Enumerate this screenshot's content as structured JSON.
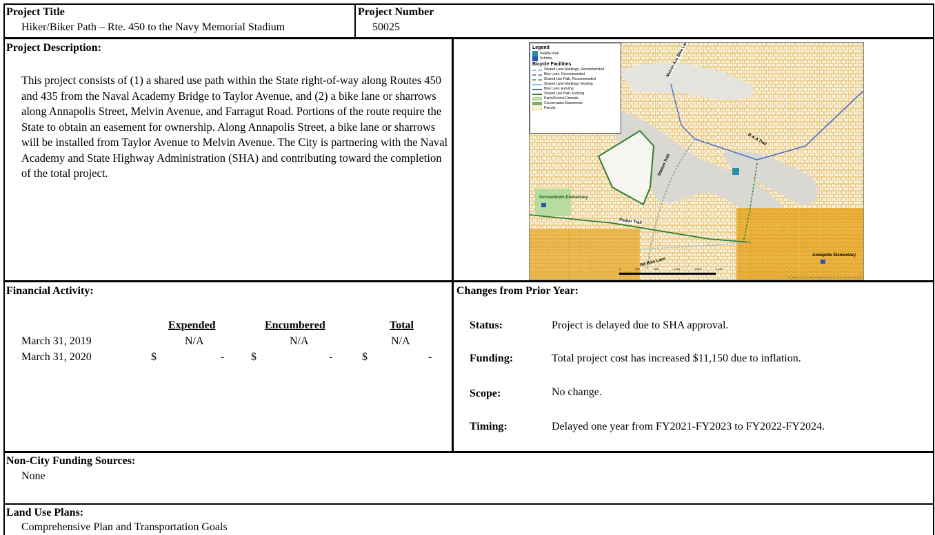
{
  "header": {
    "title_label": "Project Title",
    "title_value": "Hiker/Biker Path – Rte. 450 to the Navy Memorial Stadium",
    "number_label": "Project Number",
    "number_value": "50025"
  },
  "description": {
    "label": "Project Description:",
    "text": "This project consists of (1) a shared use path within the State right-of-way along Routes 450 and 435 from the Naval Academy Bridge to Taylor Avenue, and (2) a bike lane or sharrows along Annapolis Street, Melvin Avenue, and Farragut Road. Portions of the route require the State to obtain an easement for ownership. Along Annapolis Street, a bike lane or sharrows will be installed from Taylor Avenue to Melvin Avenue.  The City is partnering with the Naval Academy and State Highway Administration (SHA) and contributing toward the completion of the total project."
  },
  "map": {
    "legend": {
      "title": "Legend",
      "items": [
        {
          "label": "Paddle Park",
          "icon": "paddle-icon"
        },
        {
          "label": "Schools",
          "icon": "school-icon"
        }
      ],
      "section": "Bicycle Facilities",
      "facilities": [
        {
          "label": "Shared Lane Markings, Recommended",
          "color": "#8fc3d9",
          "style": "dashed"
        },
        {
          "label": "Bike Lane, Recommended",
          "color": "#7b86c4",
          "style": "dashed"
        },
        {
          "label": "Shared Use Path, Recommended",
          "color": "#6aa86a",
          "style": "dashed"
        },
        {
          "label": "Shared Lane Markings, Existing",
          "color": "#8fc3d9",
          "style": "solid"
        },
        {
          "label": "Bike Lane, Existing",
          "color": "#4f6fc9",
          "style": "solid"
        },
        {
          "label": "Shared Use Path, Existing",
          "color": "#2f7d32",
          "style": "solid"
        },
        {
          "label": "Parks/School Grounds",
          "color": "#b7dca0",
          "style": "fill"
        },
        {
          "label": "Conservation Easements",
          "color": "#7fa86a",
          "style": "fill"
        },
        {
          "label": "Parcels",
          "color": "#f2c14e",
          "style": "outline"
        }
      ]
    },
    "labels": {
      "melvin": "Melvin Ave Bike Lane",
      "bao": "B & A Trail",
      "station": "Station Trail",
      "poplar": "Poplar Trail",
      "germantown": "Germantown Elementary",
      "annapolis": "Annapolis Elementary",
      "rd_bike": "Rd Bike Lane"
    },
    "scale": [
      "0",
      "300",
      "600",
      "1,200",
      "1,800",
      "2,400"
    ],
    "credit": "Esri, HERE, Garmin, © OpenStreetMap contributors, and the GIS user community"
  },
  "financial": {
    "label": "Financial Activity:",
    "headers": {
      "expended": "Expended",
      "encumbered": "Encumbered",
      "total": "Total"
    },
    "rows": [
      {
        "date": "March 31, 2019",
        "expended": "N/A",
        "encumbered": "N/A",
        "total": "N/A"
      },
      {
        "date": "March 31, 2020",
        "cur": "$",
        "expended": "-",
        "encumbered": "-",
        "total": "-"
      }
    ]
  },
  "changes": {
    "label": "Changes from Prior Year:",
    "items": [
      {
        "key": "Status:",
        "value": "Project is delayed due to SHA approval."
      },
      {
        "key": "Funding:",
        "value": "Total project cost has increased $11,150 due to inflation."
      },
      {
        "key": "Scope:",
        "value": "No change."
      },
      {
        "key": "Timing:",
        "value": "Delayed one year from FY2021-FY2023 to FY2022-FY2024."
      }
    ]
  },
  "non_city": {
    "label": "Non-City Funding Sources:",
    "value": "None"
  },
  "land_use": {
    "label": "Land Use Plans:",
    "value": "Comprehensive Plan and Transportation Goals"
  }
}
